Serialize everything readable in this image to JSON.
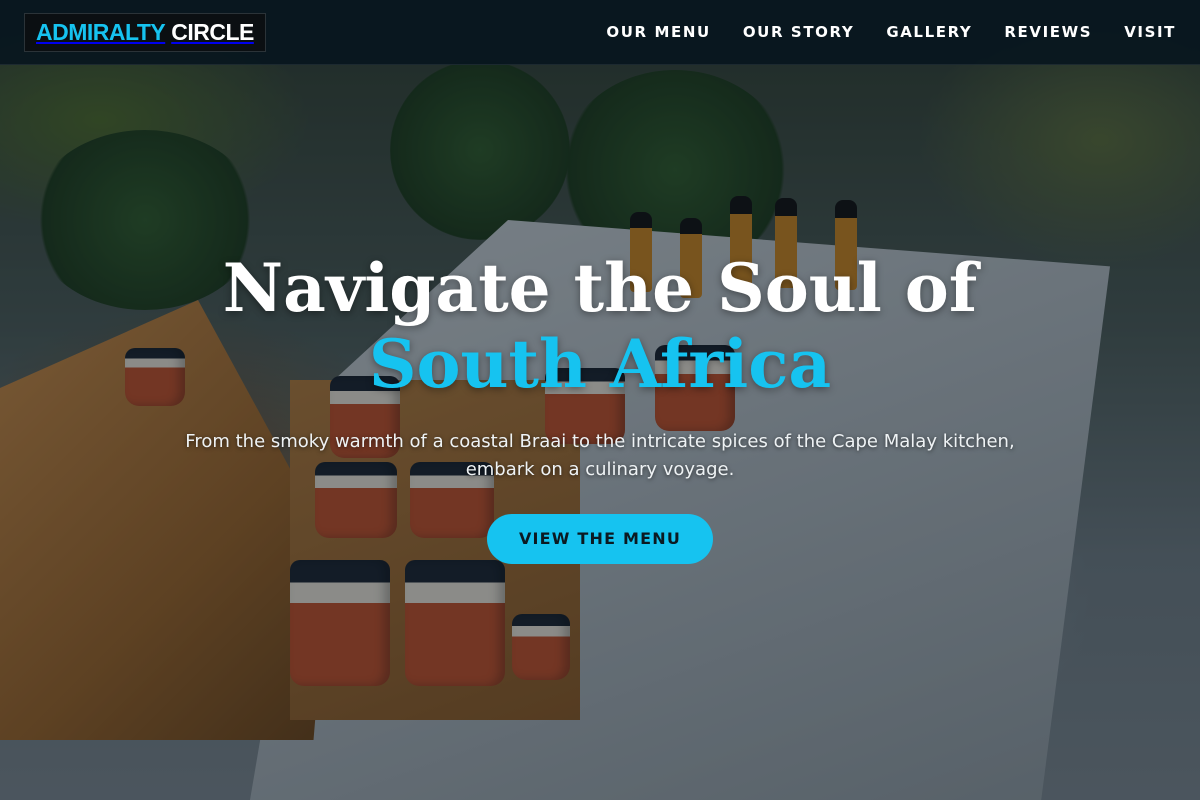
{
  "brand": {
    "logo_accent": "ADMIRALTY",
    "logo_text": "CIRCLE",
    "accent_color": "#16c3f0"
  },
  "nav": {
    "items": [
      {
        "label": "OUR MENU"
      },
      {
        "label": "OUR STORY"
      },
      {
        "label": "GALLERY"
      },
      {
        "label": "REVIEWS"
      },
      {
        "label": "VISIT"
      }
    ]
  },
  "hero": {
    "title_line1": "Navigate the Soul of",
    "title_line2": "South Africa",
    "subtitle": "From the smoky warmth of a coastal Braai to the intricate spices of the Cape Malay kitchen, embark on a culinary voyage.",
    "cta_label": "VIEW THE MENU"
  },
  "background": {
    "image_subject": "market-table-with-jars-and-sauces"
  }
}
